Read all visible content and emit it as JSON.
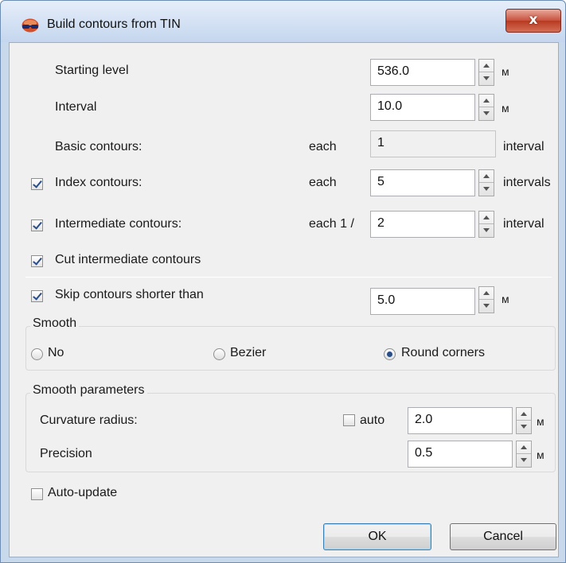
{
  "window": {
    "title": "Build contours from TIN",
    "close_label": "x"
  },
  "fields": {
    "starting_level": {
      "label": "Starting level",
      "value": "536.0",
      "unit": "м"
    },
    "interval": {
      "label": "Interval",
      "value": "10.0",
      "unit": "м"
    },
    "basic_contours": {
      "label": "Basic contours:",
      "prefix": "each",
      "value": "1",
      "suffix": "interval"
    },
    "index_contours": {
      "label": "Index contours:",
      "checked": true,
      "prefix": "each",
      "value": "5",
      "suffix": "intervals"
    },
    "intermediate_contours": {
      "label": "Intermediate contours:",
      "checked": true,
      "prefix": "each 1 /",
      "value": "2",
      "suffix": "interval"
    },
    "cut_intermediate": {
      "label": "Cut intermediate contours",
      "checked": true
    },
    "skip_shorter": {
      "label": "Skip contours shorter than",
      "checked": true,
      "value": "5.0",
      "unit": "м"
    }
  },
  "smooth": {
    "title": "Smooth",
    "options": [
      "No",
      "Bezier",
      "Round corners"
    ],
    "selected": "Round corners"
  },
  "smooth_params": {
    "title": "Smooth parameters",
    "curvature_label": "Curvature radius:",
    "auto_label": "auto",
    "auto_checked": false,
    "curvature_value": "2.0",
    "curvature_unit": "м",
    "precision_label": "Precision",
    "precision_value": "0.5",
    "precision_unit": "м"
  },
  "auto_update": {
    "label": "Auto-update",
    "checked": false
  },
  "buttons": {
    "ok": "OK",
    "cancel": "Cancel"
  },
  "icons": {
    "app": "3d-glasses-icon",
    "close": "close-icon",
    "spin": "spin-arrows-icon"
  }
}
